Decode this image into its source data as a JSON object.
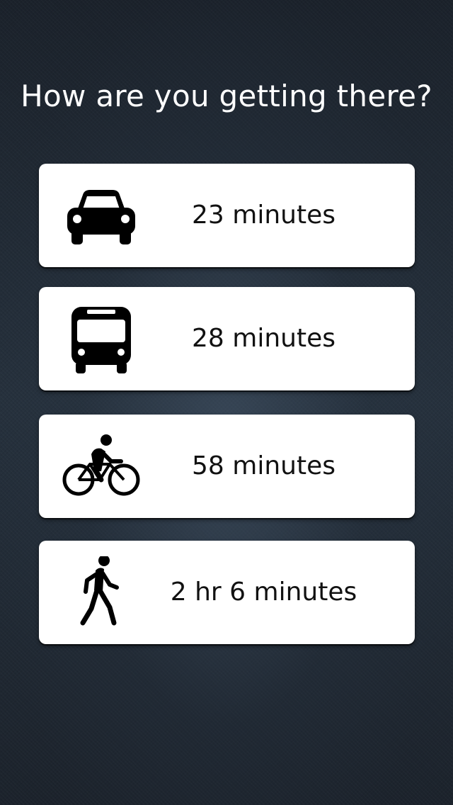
{
  "title": "How are you getting there?",
  "options": [
    {
      "mode_icon": "car-icon",
      "duration": "23 minutes"
    },
    {
      "mode_icon": "bus-icon",
      "duration": "28 minutes"
    },
    {
      "mode_icon": "bicycle-icon",
      "duration": "58 minutes"
    },
    {
      "mode_icon": "walking-icon",
      "duration": "2 hr 6 minutes"
    }
  ],
  "colors": {
    "background": "#212a34",
    "card": "#ffffff",
    "title_text": "#ffffff",
    "label_text": "#111111",
    "icon": "#000000"
  }
}
